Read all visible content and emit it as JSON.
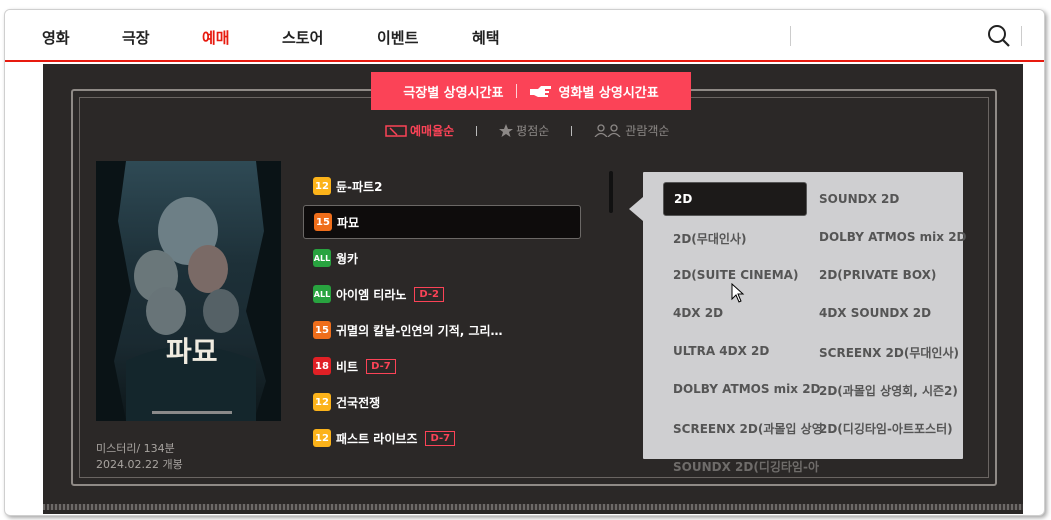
{
  "gnb": {
    "items": [
      "영화",
      "극장",
      "예매",
      "스토어",
      "이벤트",
      "혜택"
    ],
    "active": "예매"
  },
  "tabs": {
    "by_theater": "극장별 상영시간표",
    "by_movie": "영화별 상영시간표"
  },
  "sort": {
    "booking": "예매율순",
    "rating": "평점순",
    "audience": "관람객순"
  },
  "poster": {
    "title": "파묘"
  },
  "meta": {
    "genre_runtime": "미스터리/ 134분",
    "release": "2024.02.22 개봉"
  },
  "movies": [
    {
      "age": "12",
      "title": "듄-파트2",
      "dday": ""
    },
    {
      "age": "15",
      "title": "파묘",
      "dday": ""
    },
    {
      "age": "ALL",
      "title": "웡카",
      "dday": ""
    },
    {
      "age": "ALL",
      "title": "아이엠 티라노",
      "dday": "D-2"
    },
    {
      "age": "15",
      "title": "귀멸의 칼날-인연의 기적, 그리…",
      "dday": ""
    },
    {
      "age": "18",
      "title": "비트",
      "dday": "D-7"
    },
    {
      "age": "12",
      "title": "건국전쟁",
      "dday": ""
    },
    {
      "age": "12",
      "title": "패스트 라이브즈",
      "dday": "D-7"
    }
  ],
  "formats": {
    "col1": [
      "2D",
      "2D(무대인사)",
      "2D(SUITE CINEMA)",
      "4DX 2D",
      "ULTRA 4DX 2D",
      "DOLBY ATMOS mix 2D",
      "SCREENX 2D(과몰입 상영",
      "SOUNDX 2D(디깅타임-아"
    ],
    "col2": [
      "SOUNDX 2D",
      "DOLBY ATMOS mix 2D",
      "2D(PRIVATE BOX)",
      "4DX SOUNDX 2D",
      "SCREENX 2D(무대인사)",
      "2D(과몰입 상영회, 시즌2)",
      "2D(디깅타임-아트포스터)"
    ]
  },
  "colors": {
    "accent": "#fb4357",
    "nav_active": "#e71a0f",
    "background": "#2b2827"
  }
}
